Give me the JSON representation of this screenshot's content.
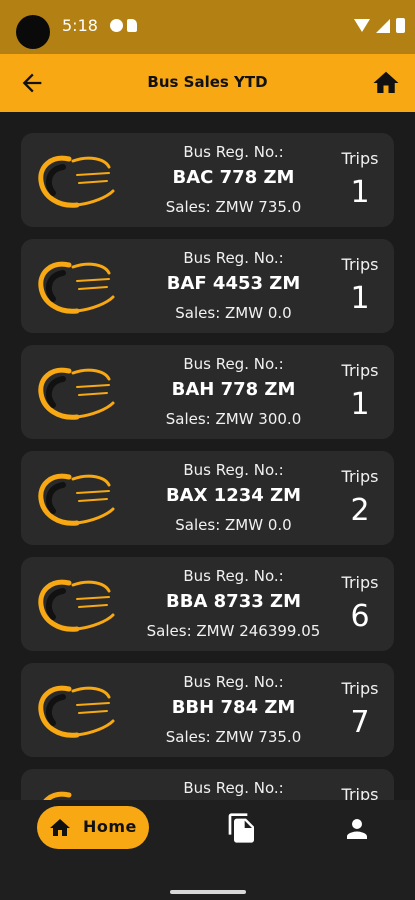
{
  "status_bar": {
    "time": "5:18"
  },
  "app_bar": {
    "title": "Bus Sales YTD"
  },
  "colors": {
    "accent": "#f7a813",
    "status_bar": "#b38013",
    "card": "#2a2a2a",
    "background": "#1b1b1b"
  },
  "labels": {
    "bus_reg": "Bus Reg. No.:",
    "trips": "Trips"
  },
  "buses": [
    {
      "reg": "BAC 778 ZM",
      "sales": "Sales: ZMW 735.0",
      "trips": "1"
    },
    {
      "reg": "BAF 4453 ZM",
      "sales": "Sales: ZMW 0.0",
      "trips": "1"
    },
    {
      "reg": "BAH 778 ZM",
      "sales": "Sales: ZMW 300.0",
      "trips": "1"
    },
    {
      "reg": "BAX 1234 ZM",
      "sales": "Sales: ZMW 0.0",
      "trips": "2"
    },
    {
      "reg": "BBA 8733 ZM",
      "sales": "Sales: ZMW 246399.05",
      "trips": "6"
    },
    {
      "reg": "BBH 784 ZM",
      "sales": "Sales: ZMW 735.0",
      "trips": "7"
    },
    {
      "reg": "",
      "sales": "",
      "trips": ""
    }
  ],
  "bottom_nav": {
    "home_label": "Home"
  },
  "icons": [
    "back-arrow-icon",
    "home-icon",
    "documents-icon",
    "profile-icon",
    "company-logo"
  ]
}
